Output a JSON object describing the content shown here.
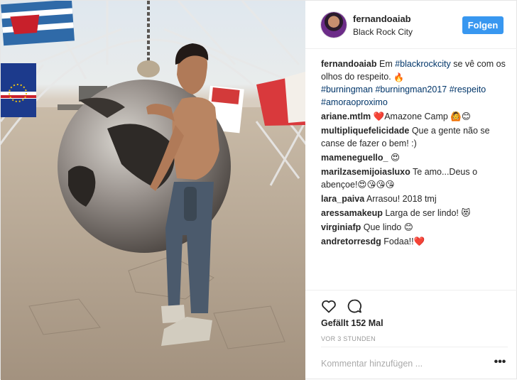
{
  "header": {
    "username": "fernandoaiab",
    "location": "Black Rock City",
    "follow_label": "Folgen"
  },
  "caption": {
    "user": "fernandoaiab",
    "text_1": "Em ",
    "tag_1": "#blackrockcity",
    "text_2": " se vê com os olhos do respeito. ",
    "emoji_1": "🔥",
    "tags_line": [
      "#burningman",
      "#burningman2017",
      "#respeito",
      "#amoraoproximo"
    ]
  },
  "comments": [
    {
      "user": "ariane.mtlm",
      "text": "❤️Amazone Camp 🙆😊"
    },
    {
      "user": "multipliquefelicidade",
      "text": "Que a gente não se canse de fazer o bem! :)"
    },
    {
      "user": "mameneguello_",
      "text": "😍"
    },
    {
      "user": "marilzasemijoiasluxo",
      "text": "Te amo...Deus o abençoe!😍😘😘😘"
    },
    {
      "user": "lara_paiva",
      "text": "Arrasou! 2018 tmj"
    },
    {
      "user": "aressamakeup",
      "text": "Larga de ser lindo! 😻"
    },
    {
      "user": "virginiafp",
      "text": "Que lindo 😊"
    },
    {
      "user": "andretorresdg",
      "text": "Fodaa!!❤️"
    }
  ],
  "likes": "Gefällt 152 Mal",
  "timestamp": "VOR 3 STUNDEN",
  "comment_placeholder": "Kommentar hinzufügen ...",
  "more_label": "•••",
  "icons": {
    "like": "heart-icon",
    "comment": "comment-bubble-icon"
  },
  "colors": {
    "follow_button": "#3897f0",
    "hashtag": "#003569",
    "secondary_text": "#999999"
  }
}
